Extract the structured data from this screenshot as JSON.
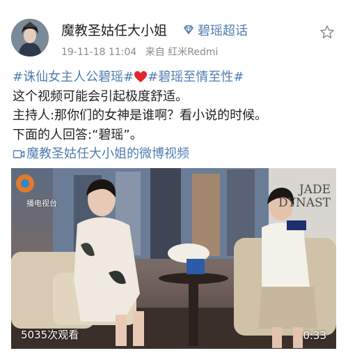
{
  "post": {
    "username": "魔教圣姑任大小姐",
    "super_topic": "碧瑶超话",
    "timestamp": "19-11-18 11:04",
    "source": "来自 红米Redmi",
    "topic_1": "#诛仙女主人公碧瑶#",
    "topic_2": "#碧瑶至情至性#",
    "line_2": "这个视频可能会引起极度舒适。",
    "line_3": "主持人:那你们的女神是谁啊？看小说的时候。",
    "line_4": "下面的人回答:“碧瑶”。",
    "video_link": "魔教圣姑任大小姐的微博视频"
  },
  "video": {
    "views": "5035次观看",
    "duration": "0:33",
    "station_text": "播电视台",
    "poster_text_1": "JADE",
    "poster_text_2": "DYNAST"
  },
  "icons": {
    "super_topic": "diamond-icon",
    "favorite": "star-icon",
    "heart": "heart-icon",
    "video": "video-icon"
  },
  "colors": {
    "link": "#507daf",
    "heart": "#e0262c",
    "meta": "#8a8a8a"
  }
}
